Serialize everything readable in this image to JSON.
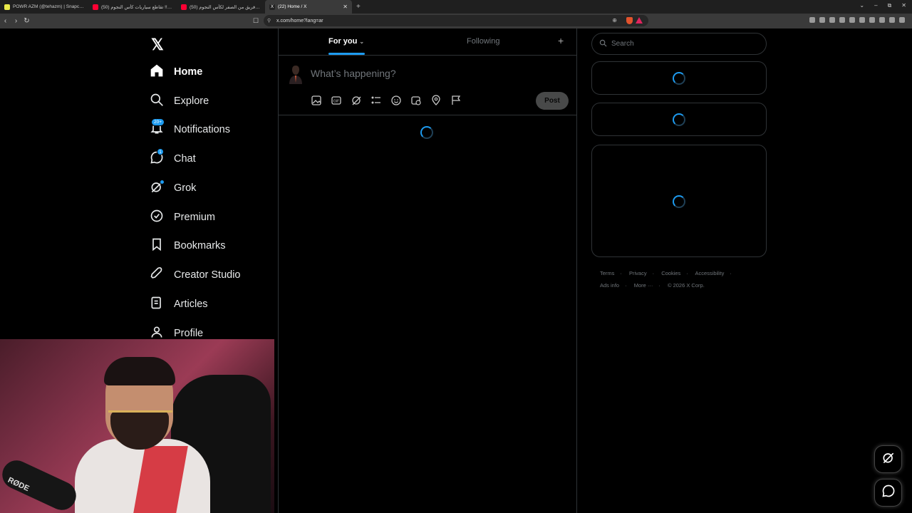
{
  "browser": {
    "tabs": [
      {
        "label": "POWR AZM (@tehazm) | Snapchat St...",
        "favicon_color": "#e9e94a"
      },
      {
        "label": "(50) تقاطع سياريات كأس النجوم !! - YouTube",
        "favicon_color": "#ff0033"
      },
      {
        "label": "(50) جهزنا فريق من الصفر لكأس النجوم...",
        "favicon_color": "#ff0033"
      },
      {
        "label": "(22) Home / X",
        "favicon_color": "#222222",
        "active": true
      }
    ],
    "new_tab_icon": "+",
    "url": "x.com/home?lang=ar",
    "window_controls": [
      "⌄",
      "–",
      "⧉",
      "✕"
    ]
  },
  "nav": {
    "logo": "𝕏",
    "items": [
      {
        "label": "Home",
        "icon": "home-icon",
        "active": true
      },
      {
        "label": "Explore",
        "icon": "search-icon"
      },
      {
        "label": "Notifications",
        "icon": "bell-icon",
        "badge": "20+"
      },
      {
        "label": "Chat",
        "icon": "chat-icon",
        "badge": "1"
      },
      {
        "label": "Grok",
        "icon": "grok-icon",
        "dot": true
      },
      {
        "label": "Premium",
        "icon": "premium-icon"
      },
      {
        "label": "Bookmarks",
        "icon": "bookmark-icon"
      },
      {
        "label": "Creator Studio",
        "icon": "rocket-icon"
      },
      {
        "label": "Articles",
        "icon": "articles-icon"
      },
      {
        "label": "Profile",
        "icon": "profile-icon"
      }
    ]
  },
  "feed": {
    "tab_for_you": "For you",
    "tab_following": "Following",
    "composer_placeholder": "What’s happening?",
    "post_button": "Post"
  },
  "sidebar": {
    "search_placeholder": "Search",
    "footer_row1": [
      "Terms",
      "Privacy",
      "Cookies",
      "Accessibility"
    ],
    "footer_row2": [
      "Ads info",
      "More ···",
      "© 2026 X Corp."
    ]
  },
  "webcam": {
    "mic_brand": "RØDE"
  },
  "colors": {
    "accent": "#1d9bf0",
    "background": "#000000",
    "border": "#2f3336"
  }
}
